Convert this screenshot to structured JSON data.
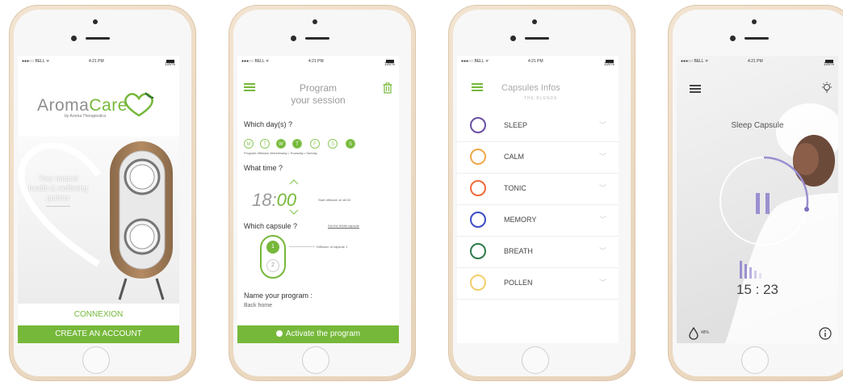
{
  "statusbar": {
    "carrier": "●●●○○ BELL ᯤ",
    "time": "4:21 PM",
    "battery": "100%"
  },
  "screen1": {
    "logo_part1": "Aroma",
    "logo_part2": "Care",
    "logo_sub": "by Aroma Therapeutics",
    "tagline": [
      "Your natural",
      "health & wellbeing",
      "partner"
    ],
    "connexion_label": "CONNEXION",
    "create_account_label": "CREATE AN ACCOUNT"
  },
  "screen2": {
    "title_line1": "Program",
    "title_line2": "your session",
    "which_days_label": "Which day(s) ?",
    "days": [
      "M",
      "T",
      "W",
      "T",
      "F",
      "S",
      "S"
    ],
    "days_selected": [
      false,
      false,
      true,
      true,
      false,
      false,
      true
    ],
    "days_summary": "Program diffusion Wednesday • Thursday • Sunday",
    "what_time_label": "What time ?",
    "time_hours": "18:",
    "time_minutes": "00",
    "time_note": "Start diffusion at 18:00.",
    "which_capsule_label": "Which capsule ?",
    "set_white_capsule_link": "Set the White capsule",
    "capsule_1": "1",
    "capsule_2": "2",
    "capsule_note": "Diffusion of capsule 1",
    "name_program_label": "Name your program :",
    "program_name_value": "Back home",
    "activate_label": "Activate the program",
    "accent_color": "#76b83a"
  },
  "screen3": {
    "title": "Capsules Infos",
    "subtitle": "THE BLENDS",
    "blends": [
      {
        "name": "SLEEP",
        "color": "#6a4fa3"
      },
      {
        "name": "CALM",
        "color": "#f0a84a"
      },
      {
        "name": "TONIC",
        "color": "#ee6b3b"
      },
      {
        "name": "MEMORY",
        "color": "#3a4cc4"
      },
      {
        "name": "BREATH",
        "color": "#2f7b4a"
      },
      {
        "name": "POLLEN",
        "color": "#f4cf6b"
      }
    ]
  },
  "screen4": {
    "title": "Sleep Capsule",
    "timer": "15 : 23",
    "progress": 0.28,
    "humidity": "48%",
    "accent_color": "#9b8fd0"
  }
}
